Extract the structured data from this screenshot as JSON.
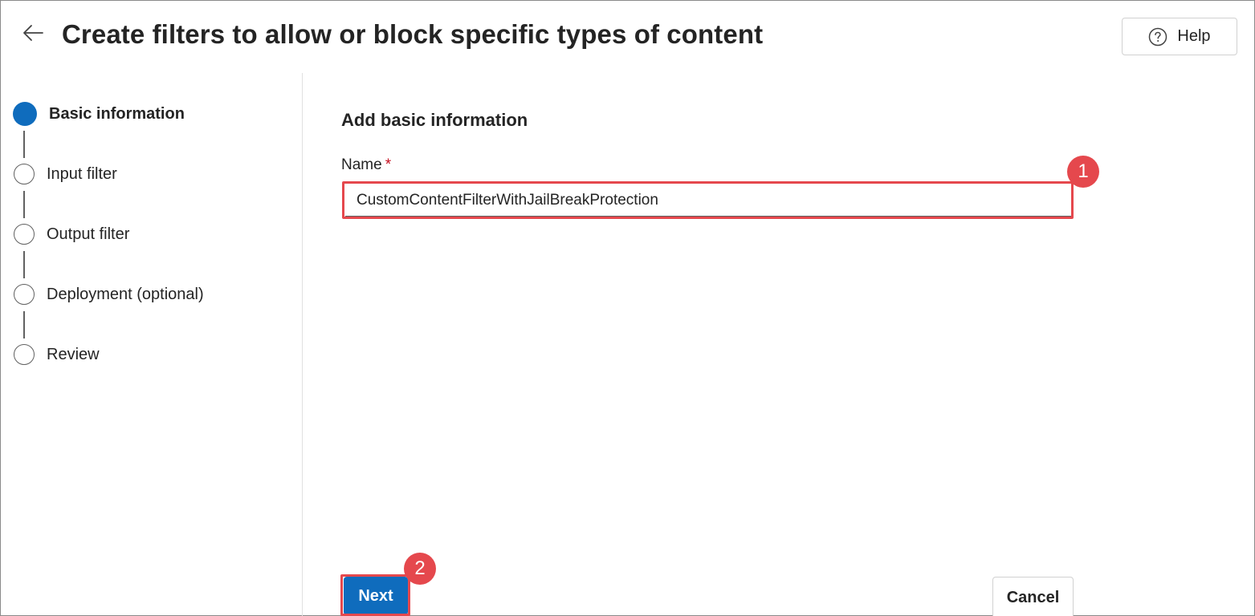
{
  "header": {
    "title": "Create filters to allow or block specific types of content",
    "back_icon": "arrow-left-icon",
    "help_label": "Help",
    "help_icon": "question-circle-icon"
  },
  "stepper": {
    "active_color": "#0f6cbd",
    "steps": [
      {
        "label": "Basic information",
        "state": "active"
      },
      {
        "label": "Input filter",
        "state": "pending"
      },
      {
        "label": "Output filter",
        "state": "pending"
      },
      {
        "label": "Deployment (optional)",
        "state": "pending"
      },
      {
        "label": "Review",
        "state": "pending"
      }
    ]
  },
  "form": {
    "section_title": "Add basic information",
    "name_label": "Name",
    "required_marker": "*",
    "name_value": "CustomContentFilterWithJailBreakProtection"
  },
  "annotations": {
    "color": "#e5484d",
    "badge_1": "1",
    "badge_2": "2"
  },
  "footer": {
    "next_label": "Next",
    "cancel_label": "Cancel"
  }
}
